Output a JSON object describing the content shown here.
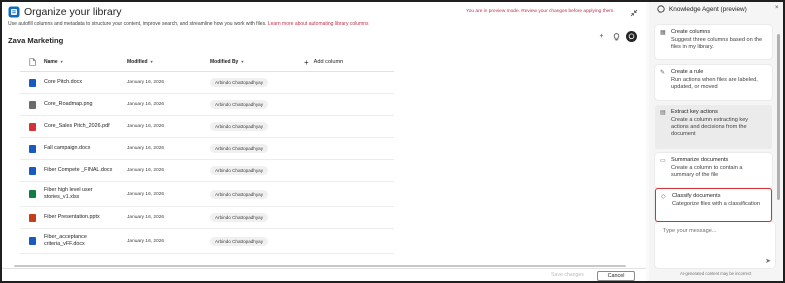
{
  "header": {
    "title": "Organize your library",
    "subtitle": "Use autofill columns and metadata to structure your content, improve search, and streamline how you work with files.",
    "subtitle_link": "Learn more about automating library columns",
    "preview_notice": "You are in preview mode. Review your changes before applying them."
  },
  "library": {
    "name": "Zava Marketing",
    "columns": {
      "name": "Name",
      "modified": "Modified",
      "modified_by": "Modified By",
      "add_column": "Add column"
    },
    "rows": [
      {
        "name": "Core Pitch.docx",
        "modified": "January 16, 2026",
        "by": "Arbindo Chattopadhyay",
        "icon": "word-icon",
        "color": "#185abd"
      },
      {
        "name": "Core_Roadmap.png",
        "modified": "January 16, 2026",
        "by": "Arbindo Chattopadhyay",
        "icon": "image-icon",
        "color": "#6b6b6b"
      },
      {
        "name": "Core_Sales Pitch_2026.pdf",
        "modified": "January 16, 2026",
        "by": "Arbindo Chattopadhyay",
        "icon": "pdf-icon",
        "color": "#d13438"
      },
      {
        "name": "Fall campaign.docx",
        "modified": "January 16, 2026",
        "by": "Arbindo Chattopadhyay",
        "icon": "word-icon",
        "color": "#185abd"
      },
      {
        "name": "Fiber Compete _FINAL.docx",
        "modified": "January 16, 2026",
        "by": "Arbindo Chattopadhyay",
        "icon": "word-icon",
        "color": "#185abd"
      },
      {
        "name": "Fiber high level user stories_v1.xlsx",
        "modified": "January 16, 2026",
        "by": "Arbindo Chattopadhyay",
        "icon": "excel-icon",
        "color": "#107c41"
      },
      {
        "name": "Fiber Presentation.pptx",
        "modified": "January 16, 2026",
        "by": "Arbindo Chattopadhyay",
        "icon": "powerpoint-icon",
        "color": "#c43e1c"
      },
      {
        "name": "Fiber_acceptance criteria_vFF.docx",
        "modified": "January 16, 2026",
        "by": "Arbindo Chattopadhyay",
        "icon": "word-icon",
        "color": "#185abd"
      }
    ]
  },
  "footer": {
    "save_label": "Save changes",
    "cancel_label": "Cancel"
  },
  "agent": {
    "title": "Knowledge Agent (preview)",
    "cards": [
      {
        "title": "Create columns",
        "desc": "Suggest three columns based on the files in my library.",
        "icon": "columns-icon"
      },
      {
        "title": "Create a rule",
        "desc": "Run actions when files are labeled, updated, or moved",
        "icon": "rule-icon"
      },
      {
        "title": "Extract key actions",
        "desc": "Create a column extracting key actions and decisions from the document",
        "icon": "extract-icon"
      },
      {
        "title": "Summarize documents",
        "desc": "Create a column to contain a summary of the file",
        "icon": "summary-icon"
      },
      {
        "title": "Classify documents",
        "desc": "Categorize files with a classification",
        "icon": "tag-icon"
      }
    ],
    "input_placeholder": "Type your message...",
    "disclaimer": "AI-generated content may be incorrect"
  },
  "colors": {
    "highlight": "#d13438",
    "preview": "#c4314b"
  }
}
